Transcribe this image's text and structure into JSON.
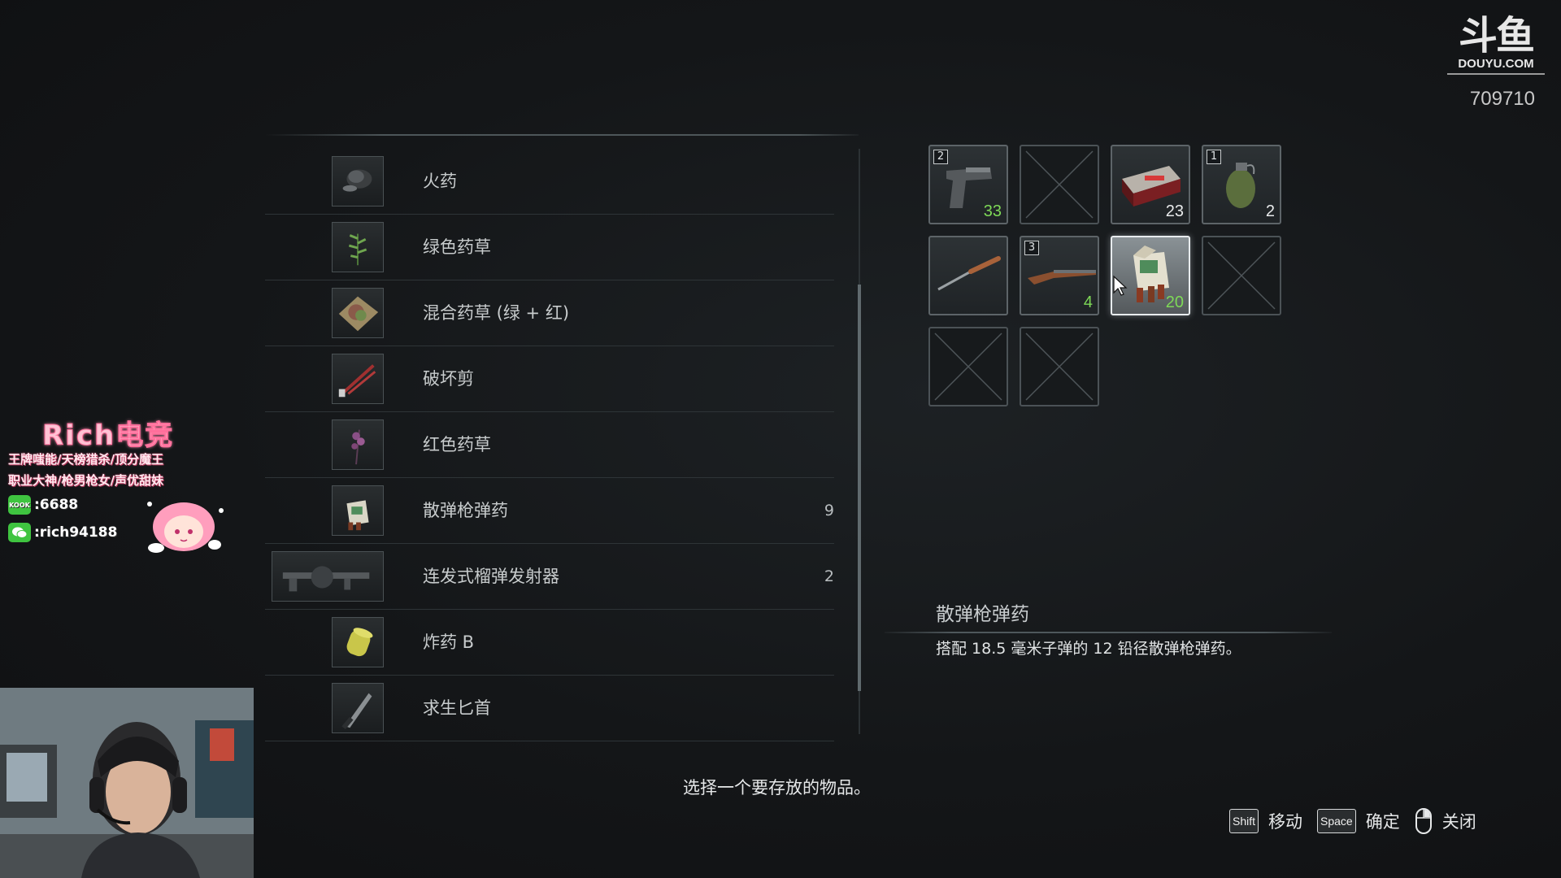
{
  "watermark": {
    "logo_text": "斗鱼",
    "domain": "DOUYU.COM",
    "room_id": "709710"
  },
  "storage_list": {
    "items": [
      {
        "name": "火药",
        "count": "",
        "icon": "gunpowder-icon"
      },
      {
        "name": "绿色药草",
        "count": "",
        "icon": "green-herb-icon"
      },
      {
        "name": "混合药草 (绿 + 红)",
        "count": "",
        "icon": "mixed-herb-icon"
      },
      {
        "name": "破坏剪",
        "count": "",
        "icon": "bolt-cutter-icon"
      },
      {
        "name": "红色药草",
        "count": "",
        "icon": "red-herb-icon"
      },
      {
        "name": "散弹枪弹药",
        "count": "9",
        "icon": "shotgun-shells-icon"
      },
      {
        "name": "连发式榴弹发射器",
        "count": "2",
        "icon": "grenade-launcher-icon"
      },
      {
        "name": "炸药 B",
        "count": "",
        "icon": "explosive-b-icon"
      },
      {
        "name": "求生匕首",
        "count": "",
        "icon": "survival-knife-icon"
      }
    ]
  },
  "inventory": {
    "slots": [
      {
        "id": "pistol",
        "index": "2",
        "qty": "33",
        "qty_color": "green",
        "icon": "pistol-icon"
      },
      {
        "id": "empty-1",
        "empty": true
      },
      {
        "id": "handgun-ammo",
        "index": "",
        "qty": "23",
        "qty_color": "white",
        "icon": "ammo-box-icon"
      },
      {
        "id": "grenade",
        "index": "1",
        "qty": "2",
        "qty_color": "white",
        "icon": "hand-grenade-icon"
      },
      {
        "id": "knife",
        "index": "",
        "qty": "",
        "icon": "combat-knife-icon"
      },
      {
        "id": "shotgun",
        "index": "3",
        "qty": "4",
        "qty_color": "green",
        "icon": "shotgun-icon"
      },
      {
        "id": "shotgun-shells",
        "index": "",
        "qty": "20",
        "qty_color": "green",
        "icon": "shotgun-shells-icon",
        "selected": true
      },
      {
        "id": "empty-2",
        "empty": true
      },
      {
        "id": "empty-3",
        "empty": true
      },
      {
        "id": "empty-4",
        "empty": true
      }
    ]
  },
  "description": {
    "title": "散弹枪弹药",
    "text": "搭配 18.5 毫米子弹的 12 铅径散弹枪弹药。"
  },
  "prompt": "选择一个要存放的物品。",
  "controls": [
    {
      "key": "Shift",
      "label": "移动"
    },
    {
      "key": "Space",
      "label": "确定"
    },
    {
      "key": "mouse-right",
      "label": "关闭"
    }
  ],
  "streamer_overlay": {
    "title": "Rich电竞",
    "tagline_1": "王牌嗤能/天榜猎杀/顶分魔王",
    "tagline_2": "职业大神/枪男枪女/声优甜妹",
    "contact_1": ":6688",
    "contact_2": ":rich94188",
    "badge_1_text": "KOOK"
  },
  "colors": {
    "background": "#141618",
    "text": "#c9cdcf",
    "qty_green": "#7ed957",
    "slot_border": "#5d6468",
    "selected_border": "#e8ecee",
    "overlay_pink": "#ff8bb0",
    "badge_green": "#3fc440"
  }
}
